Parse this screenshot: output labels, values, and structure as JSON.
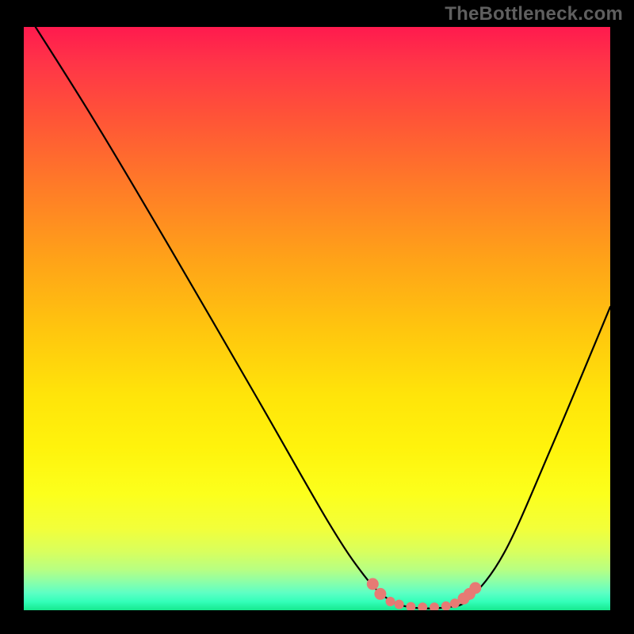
{
  "watermark": "TheBottleneck.com",
  "chart_data": {
    "type": "line",
    "title": "",
    "xlabel": "",
    "ylabel": "",
    "xlim": [
      0,
      100
    ],
    "ylim": [
      0,
      100
    ],
    "series": [
      {
        "name": "bottleneck-curve",
        "points": [
          {
            "x": 2,
            "y": 100
          },
          {
            "x": 12,
            "y": 84
          },
          {
            "x": 25,
            "y": 62
          },
          {
            "x": 40,
            "y": 36
          },
          {
            "x": 52,
            "y": 15
          },
          {
            "x": 58,
            "y": 6
          },
          {
            "x": 62,
            "y": 2
          },
          {
            "x": 66,
            "y": 0.5
          },
          {
            "x": 72,
            "y": 0.5
          },
          {
            "x": 76,
            "y": 2
          },
          {
            "x": 82,
            "y": 10
          },
          {
            "x": 90,
            "y": 28
          },
          {
            "x": 100,
            "y": 52
          }
        ]
      }
    ],
    "markers": [
      {
        "x": 59.5,
        "y": 4.5
      },
      {
        "x": 60.8,
        "y": 2.8
      },
      {
        "x": 62.5,
        "y": 1.5
      },
      {
        "x": 64,
        "y": 1.0
      },
      {
        "x": 66,
        "y": 0.6
      },
      {
        "x": 68,
        "y": 0.5
      },
      {
        "x": 70,
        "y": 0.5
      },
      {
        "x": 72,
        "y": 0.7
      },
      {
        "x": 73.5,
        "y": 1.2
      },
      {
        "x": 75,
        "y": 2.0
      },
      {
        "x": 76,
        "y": 2.8
      },
      {
        "x": 77,
        "y": 3.8
      }
    ],
    "marker_color": "#e77a74",
    "curve_color": "#000000",
    "gradient": {
      "top": "#ff1a4e",
      "mid": "#ffe40a",
      "bottom": "#16e98e"
    }
  }
}
